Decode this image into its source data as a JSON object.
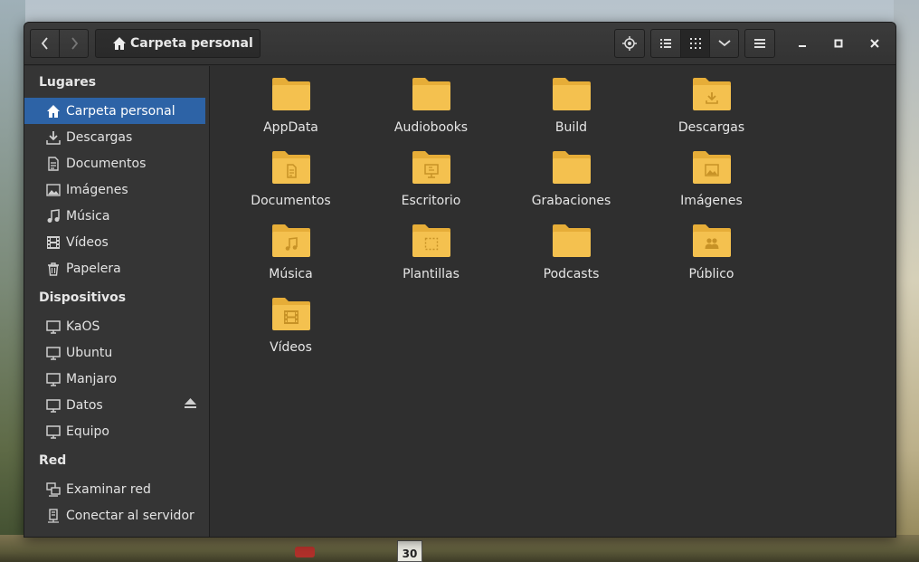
{
  "desktop": {
    "sign_text": "30"
  },
  "headerbar": {
    "path_label": "Carpeta personal",
    "back_icon": "chevron-left-icon",
    "forward_icon": "chevron-right-icon",
    "locate_icon": "crosshair-icon",
    "list_view_icon": "list-view-icon",
    "grid_view_icon": "grid-view-icon",
    "view_options_icon": "chevron-down-icon",
    "menu_icon": "hamburger-icon",
    "minimize_icon": "minimize-icon",
    "maximize_icon": "maximize-icon",
    "close_icon": "close-icon"
  },
  "sidebar": {
    "places_title": "Lugares",
    "places": [
      {
        "label": "Carpeta personal",
        "icon": "home-icon",
        "selected": true
      },
      {
        "label": "Descargas",
        "icon": "download-icon"
      },
      {
        "label": "Documentos",
        "icon": "document-icon"
      },
      {
        "label": "Imágenes",
        "icon": "image-icon"
      },
      {
        "label": "Música",
        "icon": "music-icon"
      },
      {
        "label": "Vídeos",
        "icon": "film-icon"
      },
      {
        "label": "Papelera",
        "icon": "trash-icon"
      }
    ],
    "devices_title": "Dispositivos",
    "devices": [
      {
        "label": "KaOS",
        "icon": "drive-icon"
      },
      {
        "label": "Ubuntu",
        "icon": "drive-icon"
      },
      {
        "label": "Manjaro",
        "icon": "drive-icon"
      },
      {
        "label": "Datos",
        "icon": "drive-icon",
        "ejectable": true
      },
      {
        "label": "Equipo",
        "icon": "computer-icon"
      }
    ],
    "network_title": "Red",
    "network": [
      {
        "label": "Examinar red",
        "icon": "network-icon"
      },
      {
        "label": "Conectar al servidor",
        "icon": "server-icon"
      }
    ]
  },
  "files": [
    {
      "name": "AppData",
      "emblem": "none"
    },
    {
      "name": "Audiobooks",
      "emblem": "none"
    },
    {
      "name": "Build",
      "emblem": "none"
    },
    {
      "name": "Descargas",
      "emblem": "download"
    },
    {
      "name": "Documentos",
      "emblem": "document"
    },
    {
      "name": "Escritorio",
      "emblem": "desktop"
    },
    {
      "name": "Grabaciones",
      "emblem": "none"
    },
    {
      "name": "Imágenes",
      "emblem": "image"
    },
    {
      "name": "Música",
      "emblem": "music"
    },
    {
      "name": "Plantillas",
      "emblem": "template"
    },
    {
      "name": "Podcasts",
      "emblem": "none"
    },
    {
      "name": "Público",
      "emblem": "users"
    },
    {
      "name": "Vídeos",
      "emblem": "film"
    }
  ],
  "colors": {
    "folder": "#f4c14f",
    "folder_tab": "#e6ad38",
    "emblem": "#c79226",
    "selection": "#2d63a6"
  }
}
